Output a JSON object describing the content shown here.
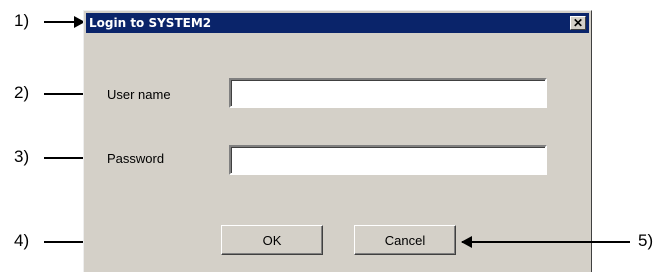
{
  "window": {
    "title": "Login to SYSTEM2",
    "close_icon": "close-icon",
    "close_glyph": "✕"
  },
  "form": {
    "username_label": "User name",
    "username_value": "",
    "password_label": "Password",
    "password_value": ""
  },
  "buttons": {
    "ok_label": "OK",
    "cancel_label": "Cancel"
  },
  "callouts": [
    "1)",
    "2)",
    "3)",
    "4)",
    "5)"
  ]
}
